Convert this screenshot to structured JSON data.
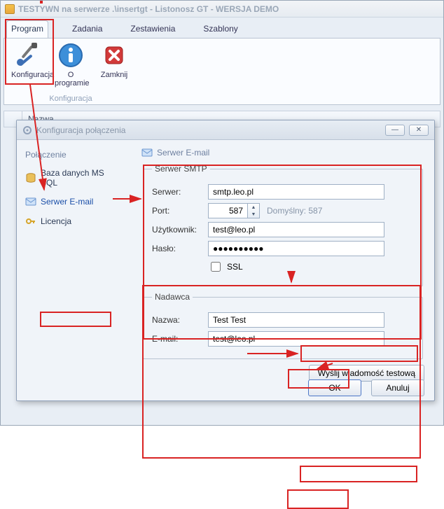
{
  "window_title": "TESTYWN na serwerze .\\insertgt - Listonosz GT - WERSJA DEMO",
  "tabs": {
    "program": "Program",
    "zadania": "Zadania",
    "zestawienia": "Zestawienia",
    "szablony": "Szablony"
  },
  "ribbon": {
    "konfiguracja": "Konfiguracja",
    "oprogramie": "O programie",
    "zamknij": "Zamknij",
    "group_label": "Konfiguracja"
  },
  "col_header": "Nazwa",
  "dialog": {
    "title": "Konfiguracja połączenia",
    "side_heading": "Połączenie",
    "side_items": {
      "db": "Baza danych MS SQL",
      "email": "Serwer E-mail",
      "license": "Licencja"
    },
    "panel_title": "Serwer E-mail",
    "smtp": {
      "legend": "Serwer SMTP",
      "server_label": "Serwer:",
      "server_value": "smtp.leo.pl",
      "port_label": "Port:",
      "port_value": "587",
      "port_hint": "Domyślny: 587",
      "user_label": "Użytkownik:",
      "user_value": "test@leo.pl",
      "pass_label": "Hasło:",
      "pass_value": "●●●●●●●●●●",
      "ssl_label": "SSL"
    },
    "sender": {
      "legend": "Nadawca",
      "name_label": "Nazwa:",
      "name_value": "Test Test",
      "email_label": "E-mail:",
      "email_value": "test@leo.pl"
    },
    "test_btn": "Wyślij wiadomość testową",
    "ok": "OK",
    "cancel": "Anuluj"
  }
}
